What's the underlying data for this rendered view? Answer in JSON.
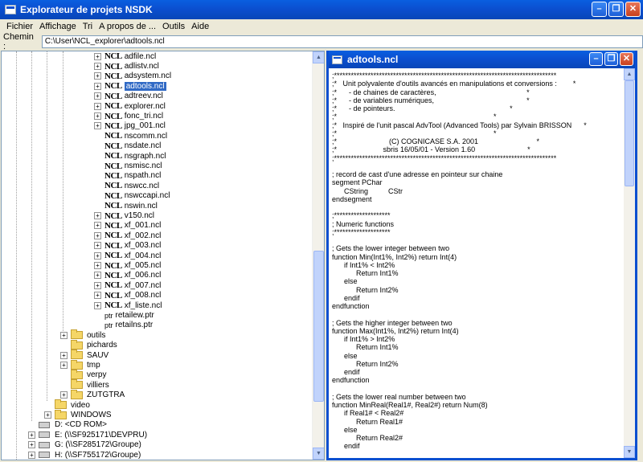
{
  "window": {
    "title": "Explorateur de projets NSDK"
  },
  "menu": [
    "Fichier",
    "Affichage",
    "Tri",
    "A propos de ...",
    "Outils",
    "Aide"
  ],
  "path": {
    "label": "Chemin :",
    "value": "C:\\User\\NCL_explorer\\adtools.ncl"
  },
  "tree": {
    "ncl_files": [
      {
        "name": "adfile.ncl",
        "expandable": true
      },
      {
        "name": "adlistv.ncl",
        "expandable": true
      },
      {
        "name": "adsystem.ncl",
        "expandable": true
      },
      {
        "name": "adtools.ncl",
        "expandable": true,
        "selected": true
      },
      {
        "name": "adtreev.ncl",
        "expandable": true
      },
      {
        "name": "explorer.ncl",
        "expandable": true
      },
      {
        "name": "fonc_tri.ncl",
        "expandable": true
      },
      {
        "name": "jpg_001.ncl",
        "expandable": true
      },
      {
        "name": "nscomm.ncl",
        "expandable": false
      },
      {
        "name": "nsdate.ncl",
        "expandable": false
      },
      {
        "name": "nsgraph.ncl",
        "expandable": false
      },
      {
        "name": "nsmisc.ncl",
        "expandable": false
      },
      {
        "name": "nspath.ncl",
        "expandable": false
      },
      {
        "name": "nswcc.ncl",
        "expandable": false
      },
      {
        "name": "nswccapi.ncl",
        "expandable": false
      },
      {
        "name": "nswin.ncl",
        "expandable": false
      },
      {
        "name": "v150.ncl",
        "expandable": true
      },
      {
        "name": "xf_001.ncl",
        "expandable": true
      },
      {
        "name": "xf_002.ncl",
        "expandable": true
      },
      {
        "name": "xf_003.ncl",
        "expandable": true
      },
      {
        "name": "xf_004.ncl",
        "expandable": true
      },
      {
        "name": "xf_005.ncl",
        "expandable": true
      },
      {
        "name": "xf_006.ncl",
        "expandable": true
      },
      {
        "name": "xf_007.ncl",
        "expandable": true
      },
      {
        "name": "xf_008.ncl",
        "expandable": true
      },
      {
        "name": "xf_liste.ncl",
        "expandable": true
      }
    ],
    "ncl_badge": "NCL",
    "ptr_badge": "ptr",
    "ptr_files": [
      "retailew.ptr",
      "retailns.ptr"
    ],
    "folders": [
      {
        "name": "outils",
        "expandable": true
      },
      {
        "name": "pichards",
        "expandable": false
      },
      {
        "name": "SAUV",
        "expandable": true
      },
      {
        "name": "tmp",
        "expandable": true
      },
      {
        "name": "verpy",
        "expandable": false
      },
      {
        "name": "villiers",
        "expandable": false
      },
      {
        "name": "ZUTGTRA",
        "expandable": true
      }
    ],
    "root_folders": [
      {
        "name": "video",
        "expandable": false
      },
      {
        "name": "WINDOWS",
        "expandable": true
      }
    ],
    "drives": [
      {
        "name": "D:  <CD ROM>",
        "expandable": false
      },
      {
        "name": "E:  (\\\\SF925171\\DEVPRU)",
        "expandable": true
      },
      {
        "name": "G:  (\\\\SF285172\\Groupe)",
        "expandable": true
      },
      {
        "name": "H:  (\\\\SF755172\\Groupe)",
        "expandable": true
      }
    ]
  },
  "editor": {
    "title": "adtools.ncl",
    "lines": [
      ";*******************************************************************************",
      ";*   Unit polyvalente d'outils avancés en manipulations et conversions :        *",
      ";*      - de chaines de caractères,                                             *",
      ";*      - de variables numériques,                                              *",
      ";*      - de pointeurs.                                                         *",
      ";*                                                                              *",
      ";*   Inspiré de l'unit pascal AdvTool (Advanced Tools) par Sylvain BRISSON      *",
      ";*                                                                              *",
      ";*                          (C) COGNICASE S.A. 2001                             *",
      ";*                       sbris 16/05/01 - Version 1.60                          *",
      ";*******************************************************************************",
      "",
      "; record de cast d'une adresse en pointeur sur chaine",
      "segment PChar",
      "      CString          CStr",
      "endsegment",
      "",
      ";********************",
      "; Numeric functions",
      ";********************",
      "",
      "; Gets the lower integer between two",
      "function Min(Int1%, Int2%) return Int(4)",
      "      if Int1% < Int2%",
      "            Return Int1%",
      "      else",
      "            Return Int2%",
      "      endif",
      "endfunction",
      "",
      "; Gets the higher integer between two",
      "function Max(Int1%, Int2%) return Int(4)",
      "      if Int1% > Int2%",
      "            Return Int1%",
      "      else",
      "            Return Int2%",
      "      endif",
      "endfunction",
      "",
      "; Gets the lower real number between two",
      "function MinReal(Real1#, Real2#) return Num(8)",
      "      if Real1# < Real2#",
      "            Return Real1#",
      "      else",
      "            Return Real2#",
      "      endif"
    ]
  }
}
